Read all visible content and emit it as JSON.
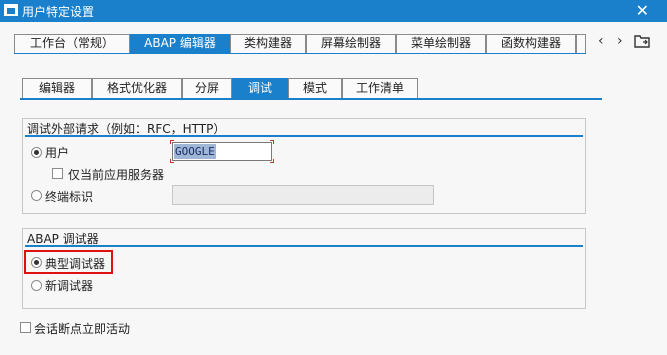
{
  "window": {
    "title": "用户特定设置",
    "close_glyph": "✕"
  },
  "main_tabs": [
    {
      "label": "工作台（常规）",
      "active": false
    },
    {
      "label": "ABAP 编辑器",
      "active": true
    },
    {
      "label": "类构建器",
      "active": false
    },
    {
      "label": "屏幕绘制器",
      "active": false
    },
    {
      "label": "菜单绘制器",
      "active": false
    },
    {
      "label": "函数构建器",
      "active": false
    }
  ],
  "tab_nav": {
    "prev_glyph": "‹",
    "next_glyph": "›"
  },
  "sub_tabs": [
    {
      "label": "编辑器",
      "active": false
    },
    {
      "label": "格式优化器",
      "active": false
    },
    {
      "label": "分屏",
      "active": false
    },
    {
      "label": "调试",
      "active": true
    },
    {
      "label": "模式",
      "active": false
    },
    {
      "label": "工作清单",
      "active": false
    }
  ],
  "external_debug": {
    "title": "调试外部请求（例如：RFC，HTTP）",
    "user_label": "用户",
    "user_selected": true,
    "user_value": "GOOGLE",
    "current_server_only_label": "仅当前应用服务器",
    "current_server_only_checked": false,
    "terminal_label": "终端标识",
    "terminal_selected": false,
    "terminal_value": ""
  },
  "abap_debugger": {
    "title": "ABAP 调试器",
    "classic_label": "典型调试器",
    "classic_selected": true,
    "new_label": "新调试器",
    "new_selected": false
  },
  "session_breakpoints": {
    "label": "会话断点立即活动",
    "checked": false
  },
  "colors": {
    "accent": "#1b80cc",
    "highlight": "#e01010"
  },
  "icons": [
    "window-icon",
    "close-icon",
    "chevron-left-icon",
    "chevron-right-icon",
    "tab-menu-icon"
  ]
}
